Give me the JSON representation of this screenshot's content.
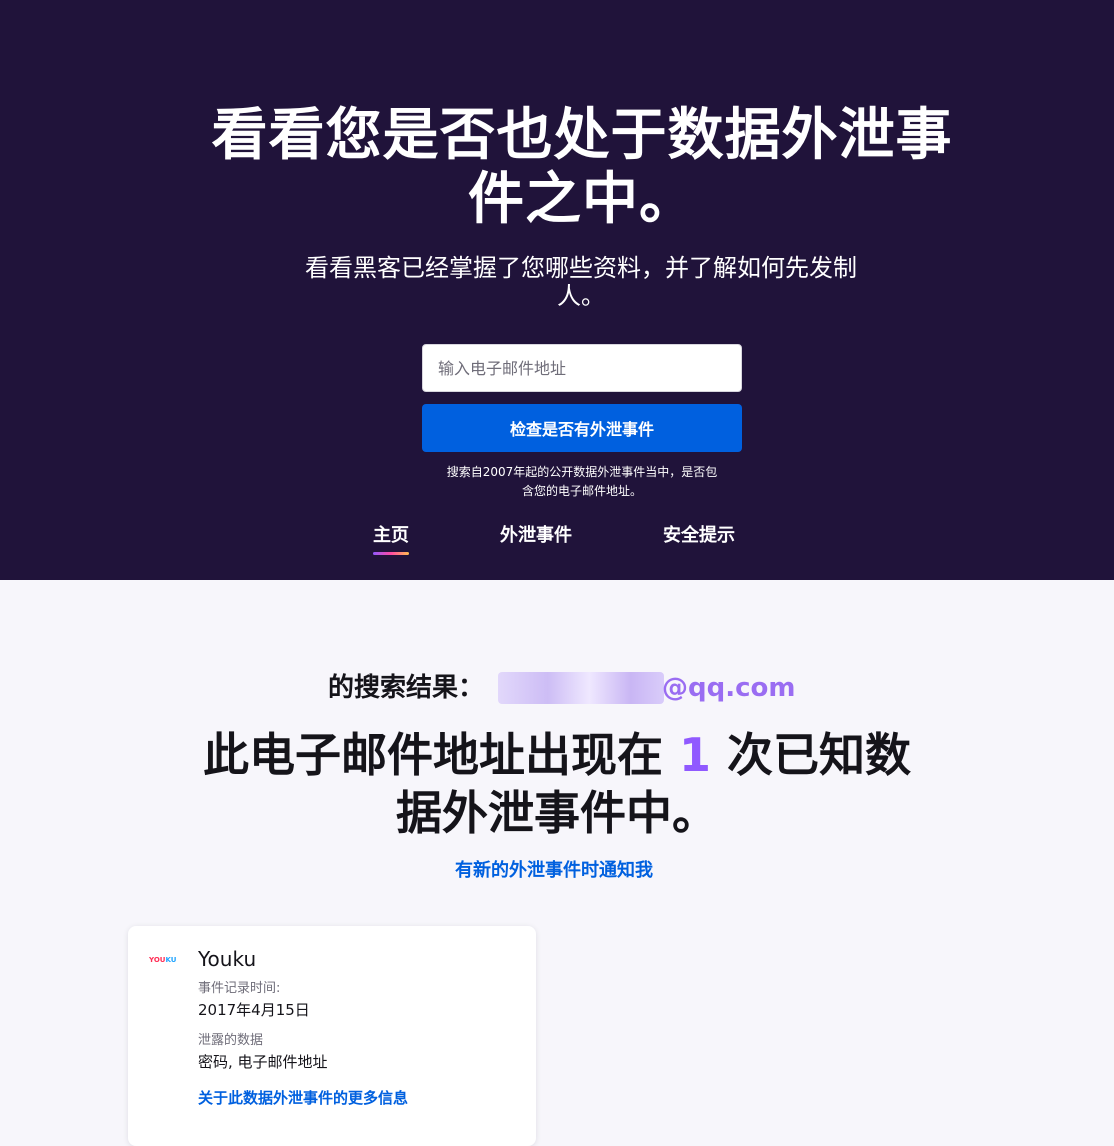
{
  "hero": {
    "title": "看看您是否也处于数据外泄事件之中。",
    "subtitle": "看看黑客已经掌握了您哪些资料，并了解如何先发制人。",
    "email_placeholder": "输入电子邮件地址",
    "check_button": "检查是否有外泄事件",
    "disclaimer": "搜索自2007年起的公开数据外泄事件当中，是否包含您的电子邮件地址。"
  },
  "nav": {
    "tabs": [
      {
        "label": "主页",
        "active": true
      },
      {
        "label": "外泄事件",
        "active": false
      },
      {
        "label": "安全提示",
        "active": false
      }
    ]
  },
  "results": {
    "label": "的搜索结果：",
    "email_domain": "@qq.com",
    "headline_before": "此电子邮件地址出现在 ",
    "count": "1",
    "headline_after": " 次已知数据外泄事件中。",
    "notify_link": "有新的外泄事件时通知我"
  },
  "breach": {
    "logo_part1": "YOU",
    "logo_part2": "KU",
    "name": "Youku",
    "date_label": "事件记录时间:",
    "date_value": "2017年4月15日",
    "data_label": "泄露的数据",
    "data_value": "密码, 电子邮件地址",
    "more_link": "关于此数据外泄事件的更多信息"
  },
  "colors": {
    "hero_bg": "#20133a",
    "primary_button": "#0060df",
    "accent_purple": "#9059ff",
    "link_blue": "#0060df"
  }
}
